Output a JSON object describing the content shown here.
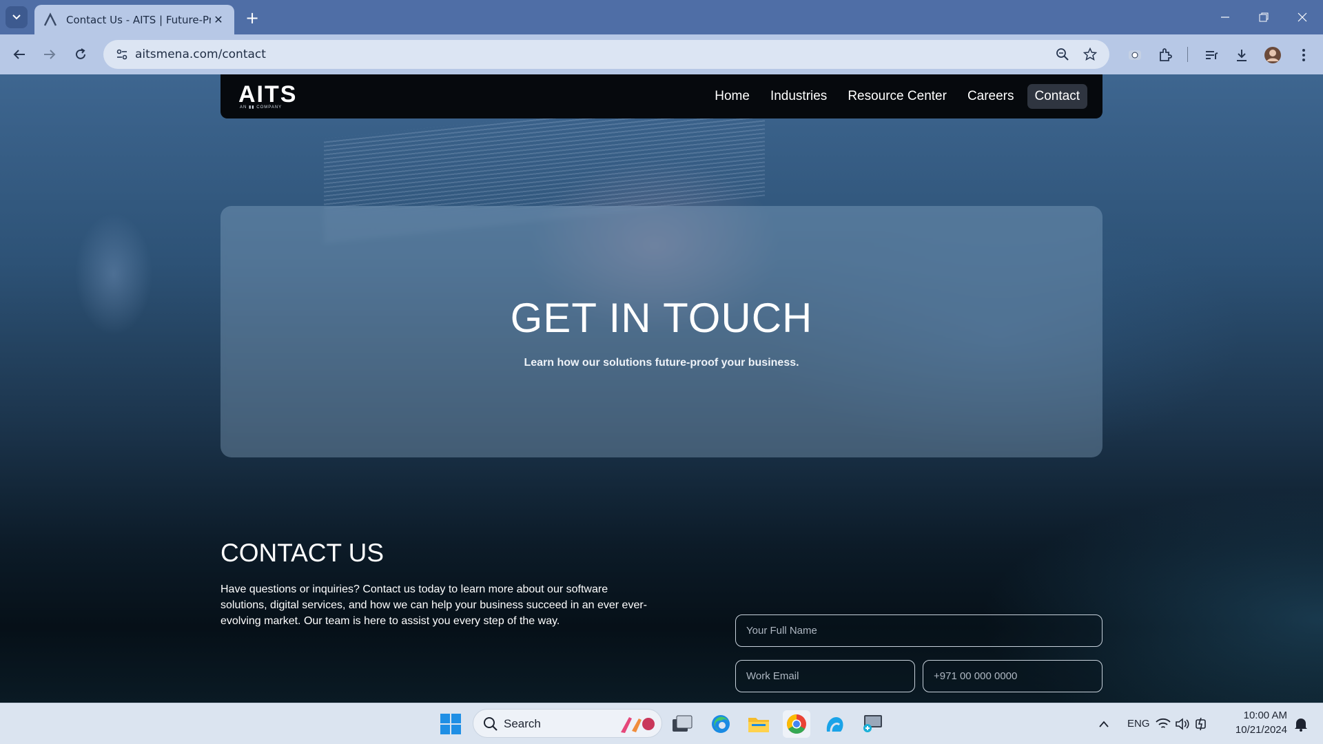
{
  "browser": {
    "tab_title": "Contact Us - AITS | Future-Proo",
    "url": "aitsmena.com/contact"
  },
  "site": {
    "logo": "AITS",
    "logo_sub": "AN ▮▮ COMPANY",
    "nav": [
      "Home",
      "Industries",
      "Resource Center",
      "Careers",
      "Contact"
    ],
    "active_nav": "Contact"
  },
  "hero": {
    "title": "GET IN TOUCH",
    "subtitle": "Learn how our solutions future-proof your business."
  },
  "contact": {
    "title": "CONTACT US",
    "text": "Have questions or inquiries? Contact us today to learn more about our software solutions, digital services, and how we can help your business succeed in an ever ever-evolving market. Our team is here to assist you every step of the way.",
    "form": {
      "name_placeholder": "Your Full Name",
      "email_placeholder": "Work Email",
      "phone_placeholder": "+971 00 000 0000"
    }
  },
  "taskbar": {
    "search_label": "Search",
    "language": "ENG",
    "time": "10:00 AM",
    "date": "10/21/2024"
  }
}
